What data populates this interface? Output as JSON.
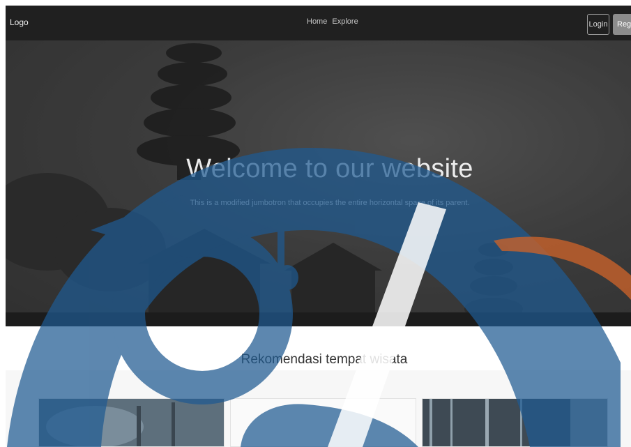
{
  "navbar": {
    "brand": "Logo",
    "links": [
      "Home",
      "Explore"
    ],
    "login_label": "Login",
    "register_label": "Register"
  },
  "hero": {
    "title": "Welcome to our website",
    "subtitle": "This is a modified jumbotron that occupies the entire horizontal space of its parent."
  },
  "recommendations": {
    "title": "Rekomendasi tempat wisata"
  },
  "colors": {
    "navbar_bg": "#202020",
    "watermark_blue": "#1f5a91",
    "accent_orange": "#c8612a"
  }
}
